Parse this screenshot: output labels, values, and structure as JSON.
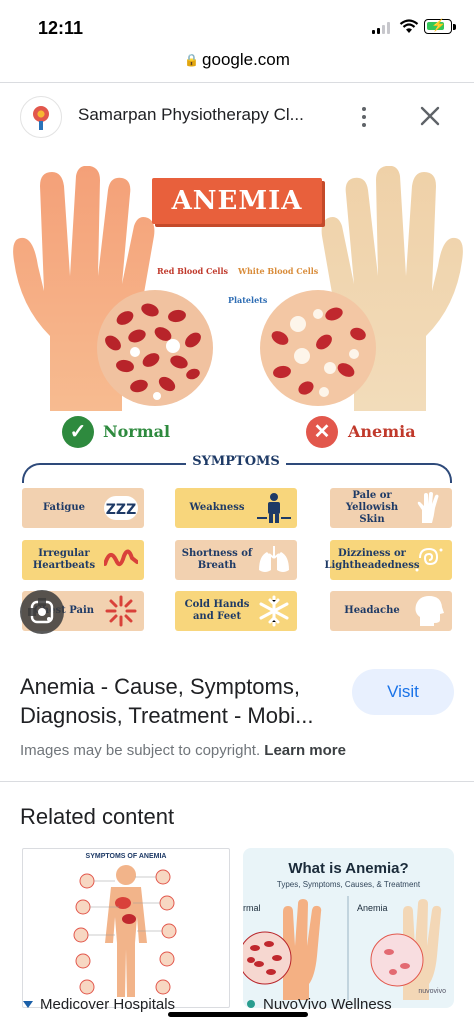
{
  "status_bar": {
    "time": "12:11",
    "battery_level": 0.75
  },
  "browser": {
    "url": "google.com"
  },
  "source": {
    "name": "Samarpan Physiotherapy Cl..."
  },
  "infographic": {
    "title": "ANEMIA",
    "red_blood_cells_label": "Red Blood Cells",
    "white_blood_cells_label": "White Blood Cells",
    "platelets_label": "Platelets",
    "normal_label": "Normal",
    "anemia_label": "Anemia",
    "symptoms_heading": "SYMPTOMS",
    "symptoms": [
      {
        "label": "Fatigue",
        "icon": "zzz-icon"
      },
      {
        "label": "Weakness",
        "icon": "person-weights-icon"
      },
      {
        "label": "Pale or Yellowish Skin",
        "icon": "hand-icon"
      },
      {
        "label": "Irregular Heartbeats",
        "icon": "heartbeat-icon"
      },
      {
        "label": "Shortness of Breath",
        "icon": "lungs-icon"
      },
      {
        "label": "Dizziness or Lightheadedness",
        "icon": "dizzy-spiral-icon"
      },
      {
        "label": "Chest Pain",
        "icon": "pain-burst-icon"
      },
      {
        "label": "Cold Hands and Feet",
        "icon": "snowflake-icon"
      },
      {
        "label": "Headache",
        "icon": "head-icon"
      }
    ],
    "colors": {
      "banner": "#e8603c",
      "navy": "#1e3a66",
      "normal_green": "#2e8a3e",
      "anemia_red": "#e2574c"
    }
  },
  "result": {
    "title": "Anemia - Cause, Symptoms, Diagnosis, Treatment - Mobi...",
    "visit_label": "Visit",
    "copyright_text": "Images may be subject to copyright.",
    "learn_more_label": "Learn more"
  },
  "related": {
    "heading": "Related content",
    "items": [
      {
        "source": "Medicover Hospitals",
        "thumb_title": "SYMPTOMS OF ANEMIA"
      },
      {
        "source": "NuvoVivo Wellness",
        "thumb_title": "What is Anemia?",
        "thumb_subtitle": "Types, Symptoms, Causes, & Treatment",
        "thumb_left_label": "rmal",
        "thumb_right_label": "Anemia",
        "thumb_brand": "nuvovivo"
      }
    ]
  }
}
